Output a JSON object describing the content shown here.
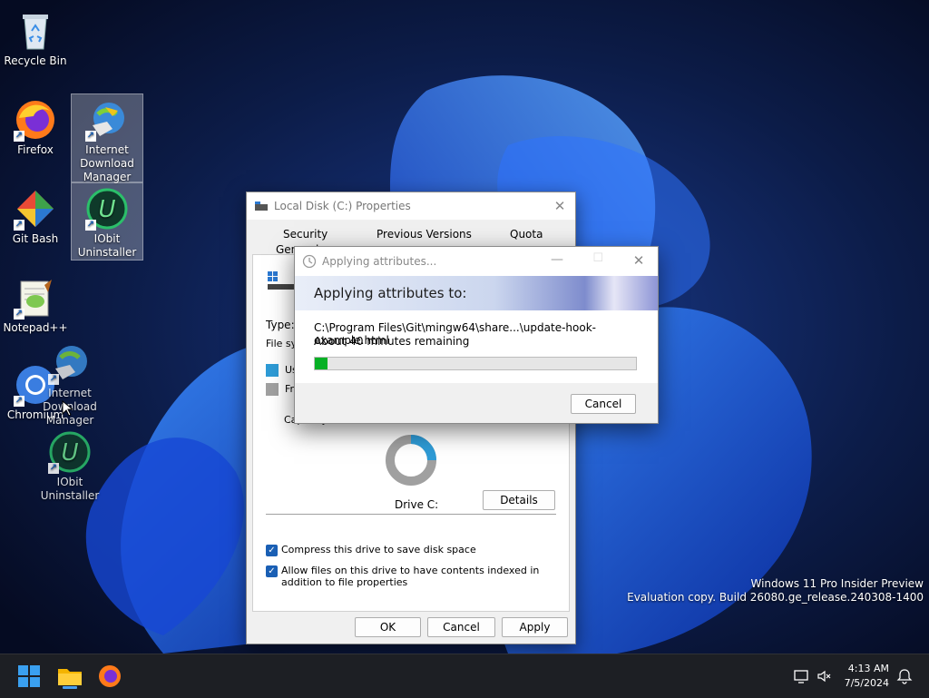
{
  "desktop": {
    "icons": [
      {
        "label": "Recycle Bin"
      },
      {
        "label": "Firefox"
      },
      {
        "label": "Internet Download Manager"
      },
      {
        "label": "Git Bash"
      },
      {
        "label": "IObit Uninstaller"
      },
      {
        "label": "Notepad++"
      },
      {
        "label": "Chromium"
      },
      {
        "label": "Internet Download Manager"
      },
      {
        "label": "IObit Uninstaller"
      }
    ],
    "watermark": {
      "line1": "Windows 11 Pro Insider Preview",
      "line2": "Evaluation copy. Build 26080.ge_release.240308-1400"
    }
  },
  "properties_window": {
    "title": "Local Disk (C:) Properties",
    "tabs_row1": [
      "Security",
      "Previous Versions",
      "Quota"
    ],
    "tab_general": "General",
    "type_label": "Type:",
    "fs_label": "File sys",
    "used_label": "Us",
    "free_label": "Fr",
    "capacity_label": "Capacity",
    "drive_label": "Drive C:",
    "details_button": "Details",
    "compress_checkbox": "Compress this drive to save disk space",
    "index_checkbox": "Allow files on this drive to have contents indexed in addition to file properties",
    "ok_button": "OK",
    "cancel_button": "Cancel",
    "apply_button": "Apply"
  },
  "apply_dialog": {
    "title": "Applying attributes...",
    "heading": "Applying attributes to:",
    "path": "C:\\Program Files\\Git\\mingw64\\share...\\update-hook-example.html",
    "remaining": "About 40 minutes remaining",
    "progress_fraction": 0.04,
    "cancel_button": "Cancel"
  },
  "taskbar": {
    "time": "4:13 AM",
    "date": "7/5/2024"
  },
  "colors": {
    "progress_fill": "#06b025",
    "accent": "#1a5fb4",
    "taskbar_bg": "#1d1f24"
  }
}
